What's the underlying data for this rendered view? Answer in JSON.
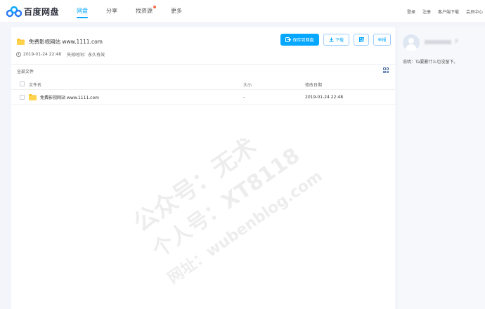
{
  "brand": {
    "name": "百度网盘",
    "accent": "#06a7ff"
  },
  "nav": {
    "items": [
      "网盘",
      "分享",
      "找资源",
      "更多"
    ],
    "active_index": 0
  },
  "top_links": [
    "登录",
    "注册",
    "客户端下载",
    "会员中心"
  ],
  "share": {
    "title": "免费影视网站 www.1111.com",
    "date": "2019-01-24 22:48",
    "expire": "失效时间：永久有效"
  },
  "actions": {
    "save": "保存到网盘",
    "download": "下载",
    "report": "举报"
  },
  "breadcrumb": "全部文件",
  "table": {
    "headers": [
      "文件名",
      "大小",
      "修改日期"
    ],
    "rows": [
      {
        "name": "免费影视网站 www.1111.com",
        "size": "-",
        "date": "2019-01-24 22:48"
      }
    ]
  },
  "side": {
    "user_suffix": "卪",
    "desc": "说明：Ta要删什么也没留下。"
  },
  "watermark": [
    "公众号：无术",
    "个人号：XT8118",
    "网址：wubenblog.com"
  ]
}
